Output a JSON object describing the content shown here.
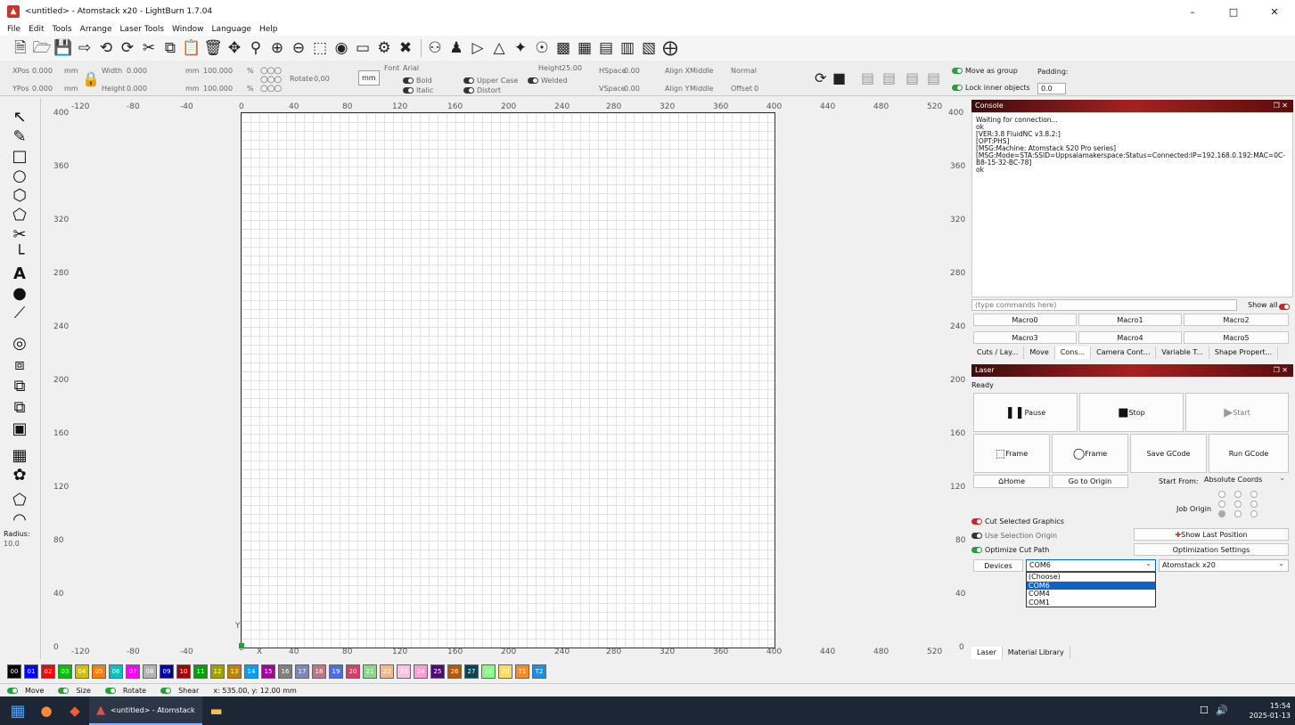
{
  "window": {
    "title": "<untitled> - Atomstack x20 - LightBurn 1.7.04",
    "min": "–",
    "max": "□",
    "close": "✕"
  },
  "menu": [
    "File",
    "Edit",
    "Tools",
    "Arrange",
    "Laser Tools",
    "Window",
    "Language",
    "Help"
  ],
  "toolbar_icons": [
    "new-file-icon",
    "open-folder-icon",
    "save-icon",
    "export-icon",
    "undo-icon",
    "redo-icon",
    "cut-icon",
    "copy-icon",
    "paste-icon",
    "delete-icon",
    "move-icon",
    "zoom-icon",
    "zoom-in-icon",
    "zoom-out-icon",
    "zoom-selection-icon",
    "camera-icon",
    "monitor-icon",
    "settings-icon",
    "tools-icon",
    "group-icon",
    "user-icon",
    "flip-icon",
    "mirror-icon",
    "weld-icon",
    "target-icon",
    "align-icon",
    "distribute-icon",
    "arrange-icon",
    "dock-icon",
    "grid-icon",
    "center-icon"
  ],
  "props": {
    "xpos_label": "XPos",
    "xpos": "0.000",
    "ypos_label": "YPos",
    "ypos": "0.000",
    "unit": "mm",
    "width_label": "Width",
    "width": "0.000",
    "height_label": "Height",
    "height": "0.000",
    "scale_w": "100.000",
    "scale_h": "100.000",
    "percent": "%",
    "rotate_label": "Rotate",
    "rotate": "0,00",
    "mm_btn": "mm",
    "font_label": "Font",
    "font": "Arial",
    "font_height_label": "Height",
    "font_height": "25.00",
    "hspace_label": "HSpace",
    "hspace": "0.00",
    "vspace_label": "VSpace",
    "vspace": "0.00",
    "alignx_label": "Align X",
    "alignx": "Middle",
    "aligny_label": "Align Y",
    "aligny": "Middle",
    "normal": "Normal",
    "offset_label": "Offset",
    "offset": "0",
    "bold": "Bold",
    "italic": "Italic",
    "upper": "Upper Case",
    "welded": "Welded",
    "distort": "Distort",
    "move_group": "Move as group",
    "lock_inner": "Lock inner objects",
    "padding_label": "Padding:",
    "padding": "0.0"
  },
  "ruler": {
    "top": [
      "-120",
      "-80",
      "-40",
      "0",
      "40",
      "80",
      "120",
      "160",
      "200",
      "240",
      "280",
      "320",
      "360",
      "400",
      "440",
      "480",
      "520"
    ],
    "bottom": [
      "-120",
      "-80",
      "-40",
      "0",
      "40",
      "80",
      "120",
      "160",
      "200",
      "240",
      "280",
      "320",
      "360",
      "400",
      "440",
      "480",
      "520"
    ],
    "left": [
      "400",
      "360",
      "320",
      "280",
      "240",
      "200",
      "160",
      "120",
      "80",
      "40",
      "0"
    ],
    "right": [
      "400",
      "360",
      "320",
      "280",
      "240",
      "200",
      "160",
      "120",
      "80",
      "40",
      "0"
    ],
    "y": "Y",
    "x": "X"
  },
  "left_tools": {
    "radius_label": "Radius:",
    "radius": "10.0"
  },
  "console": {
    "title": "Console",
    "lines": [
      "Waiting for connection...",
      "ok",
      "[VER:3.8 FluidNC v3.8.2:]",
      "[OPT:PHS]",
      "[MSG:Machine: Atomstack S20 Pro series]",
      "[MSG:Mode=STA:SSID=Uppsalamakerspace:Status=Connected:IP=192.168.0.192:MAC=0C-B8-15-32-BC-78]",
      "ok"
    ],
    "input_placeholder": "(type commands here)",
    "show_all": "Show all",
    "macros": [
      "Macro0",
      "Macro1",
      "Macro2",
      "Macro3",
      "Macro4",
      "Macro5"
    ],
    "tabs": [
      "Cuts / Lay...",
      "Move",
      "Cons...",
      "Camera Cont...",
      "Variable T...",
      "Shape Propert..."
    ]
  },
  "laser": {
    "title": "Laser",
    "status": "Ready",
    "pause": "Pause",
    "stop": "Stop",
    "start": "Start",
    "frame1": "Frame",
    "frame2": "Frame",
    "save_gcode": "Save GCode",
    "run_gcode": "Run GCode",
    "home": "Home",
    "go_origin": "Go to Origin",
    "start_from_label": "Start From:",
    "start_from": "Absolute Coords",
    "job_origin": "Job Origin",
    "cut_selected": "Cut Selected Graphics",
    "use_selection": "Use Selection Origin",
    "optimize": "Optimize Cut Path",
    "show_last": "Show Last Position",
    "opt_settings": "Optimization Settings",
    "devices": "Devices",
    "port": "COM6",
    "device": "Atomstack x20",
    "port_options": [
      "(Choose)",
      "COM6",
      "COM4",
      "COM1"
    ],
    "tabs": [
      "Laser",
      "Material Library"
    ]
  },
  "palette": [
    {
      "label": "00",
      "color": "#000000"
    },
    {
      "label": "01",
      "color": "#0000ff"
    },
    {
      "label": "02",
      "color": "#ff0000"
    },
    {
      "label": "03",
      "color": "#00c000"
    },
    {
      "label": "04",
      "color": "#d0c000"
    },
    {
      "label": "05",
      "color": "#ff8000"
    },
    {
      "label": "06",
      "color": "#00c0c0"
    },
    {
      "label": "07",
      "color": "#ff00ff"
    },
    {
      "label": "08",
      "color": "#b4b4b4"
    },
    {
      "label": "09",
      "color": "#0000a0"
    },
    {
      "label": "10",
      "color": "#a00000"
    },
    {
      "label": "11",
      "color": "#00a000"
    },
    {
      "label": "12",
      "color": "#a0a000"
    },
    {
      "label": "13",
      "color": "#c08000"
    },
    {
      "label": "14",
      "color": "#00a0ff"
    },
    {
      "label": "15",
      "color": "#a000a0"
    },
    {
      "label": "16",
      "color": "#808080"
    },
    {
      "label": "17",
      "color": "#7d87b9"
    },
    {
      "label": "18",
      "color": "#bb7784"
    },
    {
      "label": "19",
      "color": "#4a6fe3"
    },
    {
      "label": "20",
      "color": "#d33f6a"
    },
    {
      "label": "21",
      "color": "#8cd78c"
    },
    {
      "label": "22",
      "color": "#f0b98d"
    },
    {
      "label": "23",
      "color": "#f6c4e1"
    },
    {
      "label": "24",
      "color": "#fa9ed4"
    },
    {
      "label": "25",
      "color": "#500a78"
    },
    {
      "label": "26",
      "color": "#b45a00"
    },
    {
      "label": "27",
      "color": "#004754"
    },
    {
      "label": "28",
      "color": "#86fa88"
    },
    {
      "label": "29",
      "color": "#ffdb66"
    },
    {
      "label": "T1",
      "color": "#f38b2a"
    },
    {
      "label": "T2",
      "color": "#1f8fe0"
    }
  ],
  "status": {
    "move": "Move",
    "size": "Size",
    "rotate": "Rotate",
    "shear": "Shear",
    "coords": "x: 535.00, y: 12.00 mm"
  },
  "taskbar": {
    "app": "<untitled> - Atomstack",
    "time": "15:54",
    "date": "2025-01-13"
  }
}
